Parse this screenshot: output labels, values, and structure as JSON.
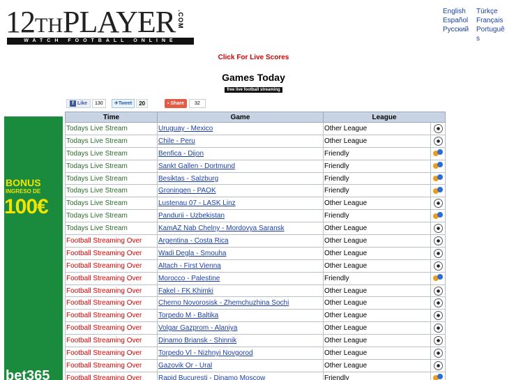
{
  "logo": {
    "main": "12",
    "th": "TH",
    "player": "PLAYER",
    "com": ".COM",
    "tagline": "WATCH FOOTBALL ONLINE"
  },
  "languages": [
    "English",
    "Türkçe",
    "Español",
    "Français",
    "Русский",
    "Português"
  ],
  "live_scores_link": "Click For Live Scores",
  "title": "Games Today",
  "subtitle": "free live football streaming",
  "social": {
    "like_label": "Like",
    "like_count": "130",
    "tweet_label": "Tweet",
    "tweet_count": "20",
    "share_label": "Share",
    "share_count": "32"
  },
  "banner": {
    "line1": "BONUS",
    "line2": "INGRESO DE",
    "amount": "100€",
    "brand": "bet365"
  },
  "table": {
    "headers": [
      "Time",
      "Game",
      "League"
    ],
    "rows": [
      {
        "time": "Todays Live Stream",
        "status": "live",
        "game": "Uruguay - Mexico",
        "league": "Other League",
        "icon": "soccer-ball-icon"
      },
      {
        "time": "Todays Live Stream",
        "status": "live",
        "game": "Chile - Peru",
        "league": "Other League",
        "icon": "soccer-ball-icon"
      },
      {
        "time": "Todays Live Stream",
        "status": "live",
        "game": "Benfica - Dijon",
        "league": "Friendly",
        "icon": "friendly-icon"
      },
      {
        "time": "Todays Live Stream",
        "status": "live",
        "game": "Sankt Gallen - Dortmund",
        "league": "Friendly",
        "icon": "friendly-icon"
      },
      {
        "time": "Todays Live Stream",
        "status": "live",
        "game": "Besiktas - Salzburg",
        "league": "Friendly",
        "icon": "friendly-icon"
      },
      {
        "time": "Todays Live Stream",
        "status": "live",
        "game": "Groningen - PAOK",
        "league": "Friendly",
        "icon": "friendly-icon"
      },
      {
        "time": "Todays Live Stream",
        "status": "live",
        "game": "Lustenau 07 - LASK Linz",
        "league": "Other League",
        "icon": "soccer-ball-icon"
      },
      {
        "time": "Todays Live Stream",
        "status": "live",
        "game": "Pandurii - Uzbekistan",
        "league": "Friendly",
        "icon": "friendly-icon"
      },
      {
        "time": "Todays Live Stream",
        "status": "live",
        "game": "KamAZ Nab Chelny - Mordovya Saransk",
        "league": "Other League",
        "icon": "soccer-ball-icon"
      },
      {
        "time": "Football Streaming Over",
        "status": "over",
        "game": "Argentina - Costa Rica",
        "league": "Other League",
        "icon": "soccer-ball-icon"
      },
      {
        "time": "Football Streaming Over",
        "status": "over",
        "game": "Wadi Degla - Smouha",
        "league": "Other League",
        "icon": "soccer-ball-icon"
      },
      {
        "time": "Football Streaming Over",
        "status": "over",
        "game": "Altach - First Vienna",
        "league": "Other League",
        "icon": "soccer-ball-icon"
      },
      {
        "time": "Football Streaming Over",
        "status": "over",
        "game": "Morocco - Palestine",
        "league": "Friendly",
        "icon": "friendly-icon"
      },
      {
        "time": "Football Streaming Over",
        "status": "over",
        "game": "Fakel - FK Khimki",
        "league": "Other League",
        "icon": "soccer-ball-icon"
      },
      {
        "time": "Football Streaming Over",
        "status": "over",
        "game": "Cherno Novorosisk - Zhemchuzhina Sochi",
        "league": "Other League",
        "icon": "soccer-ball-icon"
      },
      {
        "time": "Football Streaming Over",
        "status": "over",
        "game": "Torpedo M - Baltika",
        "league": "Other League",
        "icon": "soccer-ball-icon"
      },
      {
        "time": "Football Streaming Over",
        "status": "over",
        "game": "Volgar Gazprom - Alaniya",
        "league": "Other League",
        "icon": "soccer-ball-icon"
      },
      {
        "time": "Football Streaming Over",
        "status": "over",
        "game": "Dinamo Briansk - Shinnik",
        "league": "Other League",
        "icon": "soccer-ball-icon"
      },
      {
        "time": "Football Streaming Over",
        "status": "over",
        "game": "Torpedo Vl - Nizhnyi Novgorod",
        "league": "Other League",
        "icon": "soccer-ball-icon"
      },
      {
        "time": "Football Streaming Over",
        "status": "over",
        "game": "Gazovik Or - Ural",
        "league": "Other League",
        "icon": "soccer-ball-icon"
      },
      {
        "time": "Football Streaming Over",
        "status": "over",
        "game": "Rapid Bucuresti - Dinamo Moscow",
        "league": "Friendly",
        "icon": "friendly-icon"
      }
    ]
  }
}
